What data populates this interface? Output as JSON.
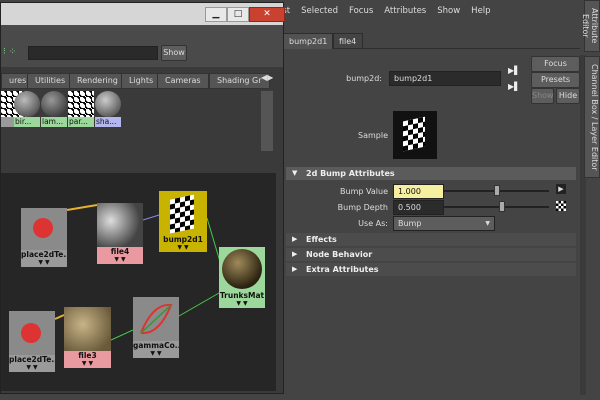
{
  "attribute_editor": {
    "menu": [
      "ist",
      "Selected",
      "Focus",
      "Attributes",
      "Show",
      "Help"
    ],
    "tabs": [
      "bump2d1",
      "file4"
    ],
    "node_label": "bump2d:",
    "node_name": "bump2d1",
    "buttons": {
      "focus": "Focus",
      "presets": "Presets",
      "show": "Show",
      "hide": "Hide"
    },
    "sample_label": "Sample",
    "sections": {
      "bump_attributes": "2d Bump Attributes",
      "effects": "Effects",
      "node_behavior": "Node Behavior",
      "extra_attributes": "Extra Attributes"
    },
    "bump_value_label": "Bump Value",
    "bump_value": "1.000",
    "bump_depth_label": "Bump Depth",
    "bump_depth": "0.500",
    "use_as_label": "Use As:",
    "use_as_value": "Bump",
    "side_tabs": {
      "attribute_editor": "Attribute Editor",
      "channel_box": "Channel Box / Layer Editor"
    },
    "accent_highlight": "#f4f0a0"
  },
  "hypershade": {
    "show_button": "Show",
    "tabs": [
      "ures",
      "Utilities",
      "Rendering",
      "Lights",
      "Cameras",
      "Shading Gr"
    ],
    "swatches": [
      "",
      "bir...",
      "lam...",
      "par...",
      "sha..."
    ],
    "nodes": {
      "place2d_top": "place2dTe...",
      "file4": "file4",
      "bump2d1": "bump2d1",
      "trunks": "TrunksMat",
      "place2d_bottom": "place2dTe...",
      "file3": "file3",
      "gamma": "gammaCo..."
    },
    "colors": {
      "texture_node": "#e89aa0",
      "bump_node": "#c8b400",
      "material_node": "#9cd89c",
      "utility_node": "#9a9a9a"
    }
  }
}
